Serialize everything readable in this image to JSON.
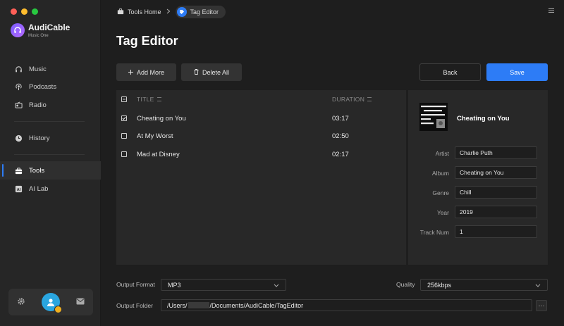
{
  "app": {
    "name": "AudiCable",
    "subtitle": "Music One"
  },
  "window_controls": [
    {
      "name": "close",
      "color": "#fe5f57"
    },
    {
      "name": "minimize",
      "color": "#febc2e"
    },
    {
      "name": "maximize",
      "color": "#28c840"
    }
  ],
  "sidebar": {
    "items": [
      {
        "label": "Music",
        "icon": "headphones-icon"
      },
      {
        "label": "Podcasts",
        "icon": "podcast-icon"
      },
      {
        "label": "Radio",
        "icon": "radio-icon"
      },
      {
        "label": "History",
        "icon": "clock-icon"
      },
      {
        "label": "Tools",
        "icon": "toolbox-icon",
        "active": true
      },
      {
        "label": "AI Lab",
        "icon": "ai-icon"
      }
    ]
  },
  "breadcrumb": {
    "home": "Tools Home",
    "current": "Tag Editor"
  },
  "page": {
    "title": "Tag Editor"
  },
  "toolbar": {
    "add_more": "Add More",
    "delete_all": "Delete All",
    "back": "Back",
    "save": "Save"
  },
  "table": {
    "headers": {
      "title": "TITLE",
      "duration": "DURATION"
    },
    "rows": [
      {
        "title": "Cheating on You",
        "duration": "03:17",
        "checked": true
      },
      {
        "title": "At My Worst",
        "duration": "02:50",
        "checked": false
      },
      {
        "title": "Mad at Disney",
        "duration": "02:17",
        "checked": false
      }
    ]
  },
  "details": {
    "track_title": "Cheating on You",
    "fields": [
      {
        "label": "Artist",
        "value": "Charlie Puth"
      },
      {
        "label": "Album",
        "value": "Cheating on You"
      },
      {
        "label": "Genre",
        "value": "Chill"
      },
      {
        "label": "Year",
        "value": "2019"
      },
      {
        "label": "Track Num",
        "value": "1"
      }
    ]
  },
  "output": {
    "format_label": "Output Format",
    "format_value": "MP3",
    "quality_label": "Quality",
    "quality_value": "256kbps",
    "folder_label": "Output Folder",
    "folder_prefix": "/Users/",
    "folder_suffix": "/Documents/AudiCable/TagEditor",
    "more_button": "···"
  },
  "colors": {
    "accent": "#2d7cf6",
    "background": "#1e1e1e",
    "panel": "#282828",
    "sidebar": "#262626"
  }
}
